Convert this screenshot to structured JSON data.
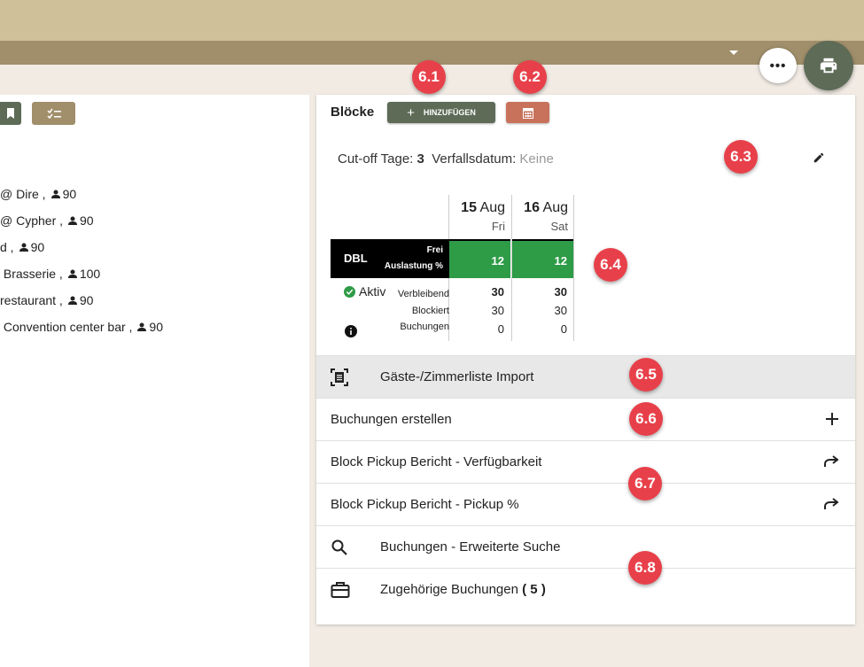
{
  "header": {
    "more_label": "•••"
  },
  "left_list": [
    {
      "text": "@ Dire ,",
      "count": "90"
    },
    {
      "text": "@ Cypher ,",
      "count": "90"
    },
    {
      "text": "d ,",
      "count": "90"
    },
    {
      "text": " Brasserie ,",
      "count": "100"
    },
    {
      "text": "restaurant ,",
      "count": "90"
    },
    {
      "text": " Convention center bar ,",
      "count": "90"
    }
  ],
  "blocks": {
    "title": "Blöcke",
    "add_label": "HINZUFÜGEN",
    "cutoff_label": "Cut-off Tage:",
    "cutoff_value": "3",
    "expiry_label": "Verfallsdatum:",
    "expiry_value": "Keine",
    "dates": [
      {
        "day": "15",
        "month": "Aug",
        "weekday": "Fri"
      },
      {
        "day": "16",
        "month": "Aug",
        "weekday": "Sat"
      }
    ],
    "room_type": "DBL",
    "frei_label": "Frei",
    "auslastung_label": "Auslastung %",
    "frei_values": [
      "12",
      "12"
    ],
    "status": "Aktiv",
    "verbleibend_label": "Verbleibend",
    "blockiert_label": "Blockiert",
    "buchungen_label": "Buchungen",
    "verbleibend": [
      "30",
      "30"
    ],
    "blockiert": [
      "30",
      "30"
    ],
    "buchungen": [
      "0",
      "0"
    ]
  },
  "actions": {
    "import": "Gäste-/Zimmerliste Import",
    "create": "Buchungen erstellen",
    "report_avail": "Block Pickup Bericht - Verfügbarkeit",
    "report_pickup": "Block Pickup Bericht - Pickup %",
    "search": "Buchungen - Erweiterte Suche",
    "related": "Zugehörige Buchungen",
    "related_count": "( 5 )"
  },
  "badges": [
    "6.1",
    "6.2",
    "6.3",
    "6.4",
    "6.5",
    "6.6",
    "6.7",
    "6.8"
  ],
  "colors": {
    "accent_green": "#5d6b57",
    "accent_tan": "#a18f6b",
    "accent_red": "#c8725c",
    "status_green": "#2e9b47",
    "badge_red": "#e8404a"
  }
}
